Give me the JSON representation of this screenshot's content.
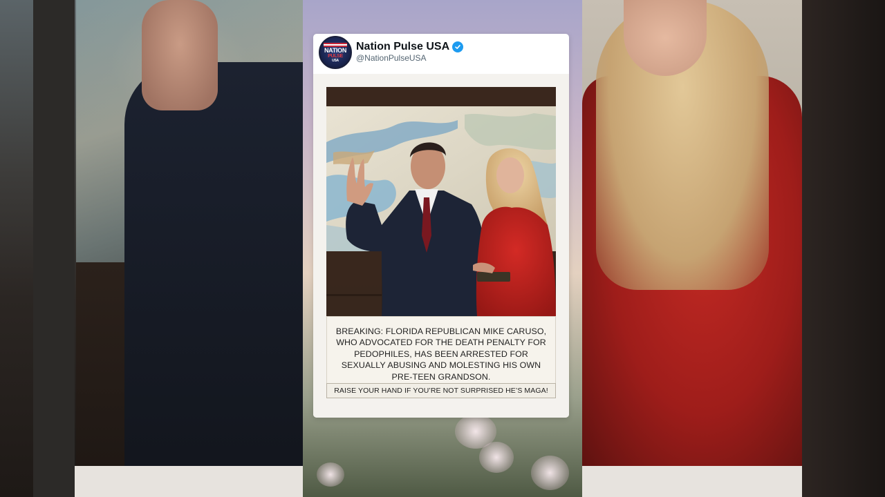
{
  "post": {
    "account_name": "Nation Pulse USA",
    "account_handle": "@NationPulseUSA",
    "avatar_text": {
      "line1": "NATION",
      "line2": "PULSE",
      "line3": "USA"
    },
    "caption": "BREAKING: FLORIDA REPUBLICAN MIKE CARUSO, WHO ADVOCATED FOR THE DEATH PENALTY FOR PEDOPHILES, HAS BEEN ARRESTED FOR SEXUALLY ABUSING AND MOLESTING HIS OWN PRE-TEEN GRANDSON.",
    "tagline": "RAISE YOUR HAND IF YOU’RE NOT SURPRISED HE’S MAGA!"
  },
  "icons": {
    "verified": "verified-badge-icon"
  },
  "colors": {
    "verified_blue": "#1d9bf0",
    "coat_red": "#c21f1c",
    "suit_navy": "#1b2233"
  }
}
